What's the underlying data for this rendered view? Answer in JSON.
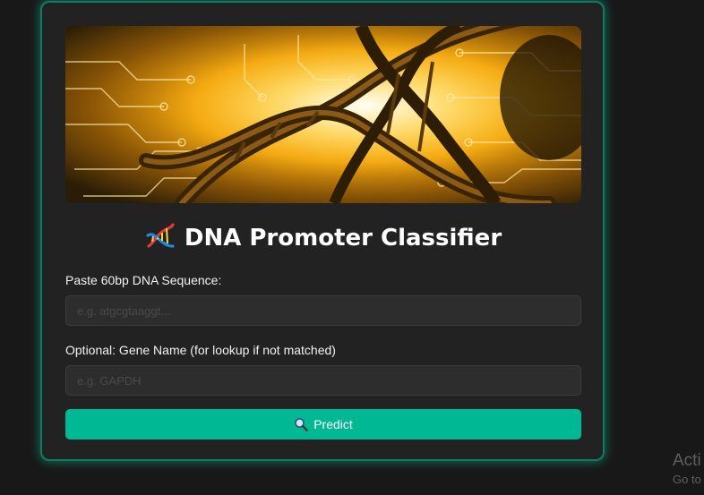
{
  "card": {
    "banner": {
      "description_icon": "dna-helix-banner",
      "accent": "#f3a70f"
    },
    "title_icon": "dna-icon",
    "title": "DNA Promoter Classifier",
    "sequence_field": {
      "label": "Paste 60bp DNA Sequence:",
      "value": "",
      "placeholder": "e.g. atgcgtaaggt..."
    },
    "gene_field": {
      "label": "Optional: Gene Name (for lookup if not matched)",
      "value": "",
      "placeholder": "e.g. GAPDH"
    },
    "predict_button": {
      "icon": "search-icon",
      "label": "Predict"
    }
  },
  "watermark": {
    "title": "Acti",
    "subtitle": "Go to"
  },
  "colors": {
    "background": "#181818",
    "card": "#222222",
    "card_border": "#127a5f",
    "button": "#00b894",
    "input": "#2d2d2d"
  }
}
